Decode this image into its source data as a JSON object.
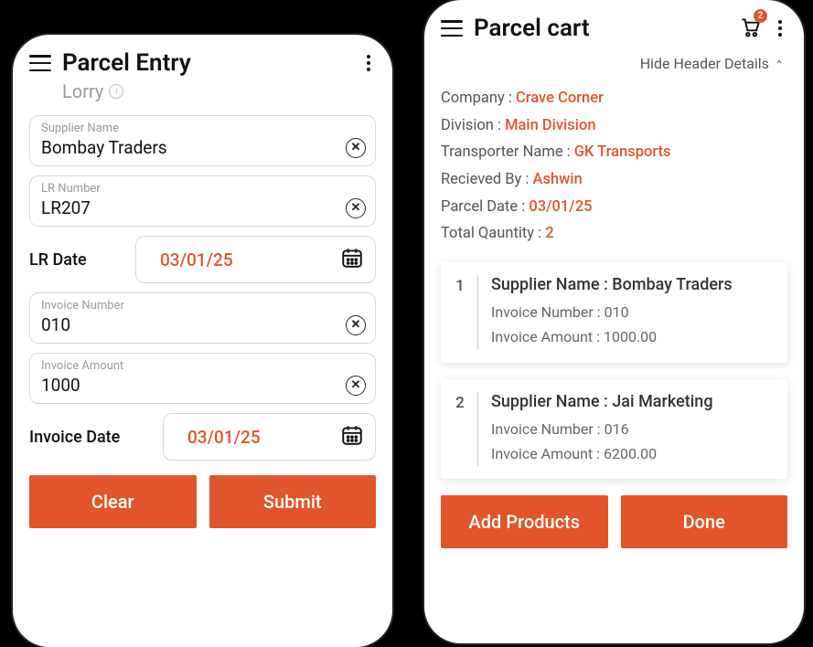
{
  "left": {
    "title": "Parcel Entry",
    "subtitle": "Lorry",
    "fields": {
      "supplier": {
        "label": "Supplier Name",
        "value": "Bombay Traders"
      },
      "lrnum": {
        "label": "LR Number",
        "value": "LR207"
      },
      "invnum": {
        "label": "Invoice Number",
        "value": "010"
      },
      "invamt": {
        "label": "Invoice Amount",
        "value": "1000"
      }
    },
    "lrdate": {
      "label": "LR Date",
      "value": "03/01/25"
    },
    "invdate": {
      "label": "Invoice Date",
      "value": "03/01/25"
    },
    "clear": "Clear",
    "submit": "Submit"
  },
  "right": {
    "title": "Parcel cart",
    "cart_count": "2",
    "hide_label": "Hide Header Details",
    "meta": {
      "company": {
        "label": "Company :  ",
        "value": "Crave Corner"
      },
      "division": {
        "label": "Division :  ",
        "value": "Main Division"
      },
      "transporter": {
        "label": "Transporter Name :  ",
        "value": "GK Transports"
      },
      "received": {
        "label": "Recieved By :   ",
        "value": "Ashwin"
      },
      "pdate": {
        "label": "Parcel Date :  ",
        "value": "03/01/25"
      },
      "qty": {
        "label": "Total Qauntity :  ",
        "value": "2"
      }
    },
    "cards": {
      "c1": {
        "num": "1",
        "sup_label": "Supplier Name : ",
        "sup_value": "Bombay Traders",
        "inv_num_label": "Invoice Number : ",
        "inv_num_value": "010",
        "inv_amt_label": "Invoice Amount : ",
        "inv_amt_value": "1000.00"
      },
      "c2": {
        "num": "2",
        "sup_label": "Supplier Name : ",
        "sup_value": "Jai Marketing",
        "inv_num_label": "Invoice Number : ",
        "inv_num_value": "016",
        "inv_amt_label": "Invoice Amount : ",
        "inv_amt_value": "6200.00"
      }
    },
    "add": "Add Products",
    "done": "Done"
  }
}
